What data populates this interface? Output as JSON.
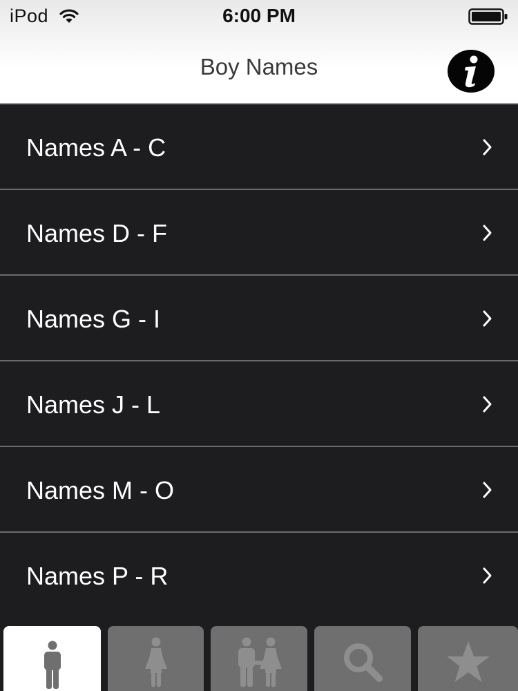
{
  "status_bar": {
    "carrier": "iPod",
    "time": "6:00 PM",
    "wifi_icon": "wifi-icon",
    "battery_icon": "battery-full-icon"
  },
  "nav_bar": {
    "title": "Boy Names",
    "info_icon": "info-icon"
  },
  "list": {
    "items": [
      {
        "label": "Names A - C"
      },
      {
        "label": "Names D - F"
      },
      {
        "label": "Names G - I"
      },
      {
        "label": "Names J - L"
      },
      {
        "label": "Names M - O"
      },
      {
        "label": "Names P - R"
      }
    ],
    "chevron_icon": "chevron-right-icon"
  },
  "tab_bar": {
    "tabs": [
      {
        "icon": "boy-icon",
        "selected": true
      },
      {
        "icon": "girl-icon",
        "selected": false
      },
      {
        "icon": "couple-icon",
        "selected": false
      },
      {
        "icon": "search-icon",
        "selected": false
      },
      {
        "icon": "star-icon",
        "selected": false
      }
    ]
  },
  "colors": {
    "list_background": "#1d1c1e",
    "separator": "#6b6a6c",
    "tab_inactive": "#6f6f70",
    "tab_active": "#ffffff"
  }
}
